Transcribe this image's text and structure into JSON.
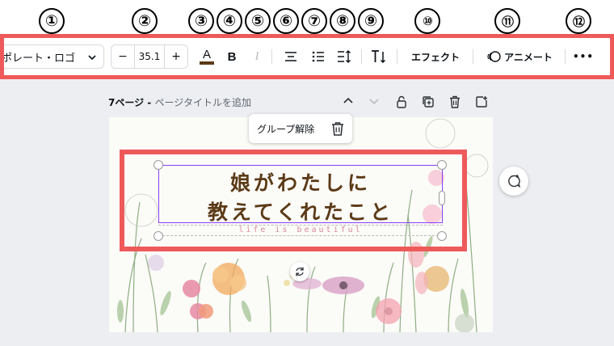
{
  "markers": [
    "①",
    "②",
    "③",
    "④",
    "⑤",
    "⑥",
    "⑦",
    "⑧",
    "⑨",
    "⑩",
    "⑪",
    "⑫"
  ],
  "toolbar": {
    "font_name": "ポレート・ロゴ",
    "font_size": "35.1",
    "minus_label": "−",
    "plus_label": "+",
    "text_color_glyph": "A",
    "text_color": "#5b3a16",
    "bold_label": "B",
    "italic_label": "I",
    "effects_label": "エフェクト",
    "animate_label": "アニメート",
    "more_label": "•••",
    "icons": [
      "chevron-down-icon",
      "text-color-icon",
      "bold-icon",
      "italic-icon",
      "align-center-icon",
      "list-icon",
      "spacing-icon",
      "vertical-text-icon",
      "animate-icon",
      "more-icon"
    ]
  },
  "page_header": {
    "page_label": "7ページ - ",
    "title_placeholder": "ページタイトルを追加",
    "icons": [
      "chevron-up-icon",
      "chevron-down-icon",
      "lock-icon",
      "duplicate-icon",
      "trash-icon",
      "add-page-icon"
    ]
  },
  "context_menu": {
    "ungroup_label": "グループ解除",
    "icon": "trash-icon"
  },
  "design": {
    "headline_line1": "娘がわたしに",
    "headline_line2": "教えてくれたこと",
    "subline": "life is beautiful",
    "headline_color": "#5b3a16",
    "accent_color": "#ee5a5a",
    "selection_color": "#8b3dff"
  }
}
